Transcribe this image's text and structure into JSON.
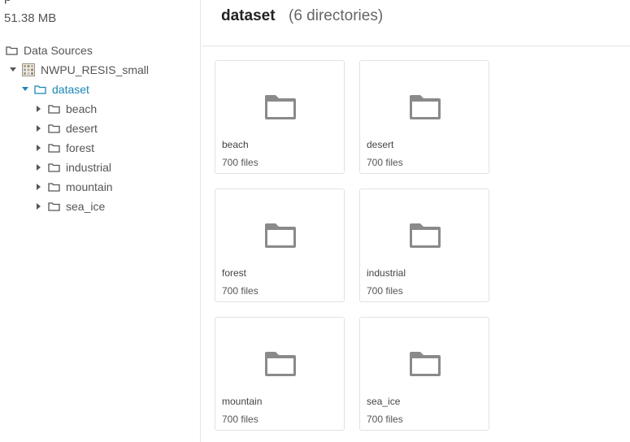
{
  "sidebar": {
    "top_char": "p",
    "size": "51.38 MB",
    "tree": {
      "data_sources": "Data Sources",
      "project": "NWPU_RESIS_small",
      "dataset": "dataset",
      "folders": [
        "beach",
        "desert",
        "forest",
        "industrial",
        "mountain",
        "sea_ice"
      ]
    }
  },
  "main": {
    "title": "dataset",
    "count": "(6 directories)",
    "cards": [
      {
        "name": "beach",
        "files": "700 files"
      },
      {
        "name": "desert",
        "files": "700 files"
      },
      {
        "name": "forest",
        "files": "700 files"
      },
      {
        "name": "industrial",
        "files": "700 files"
      },
      {
        "name": "mountain",
        "files": "700 files"
      },
      {
        "name": "sea_ice",
        "files": "700 files"
      }
    ]
  },
  "colors": {
    "accent": "#1b86b5",
    "folder_icon": "#8a8a8a",
    "border": "#e2e2e2"
  }
}
